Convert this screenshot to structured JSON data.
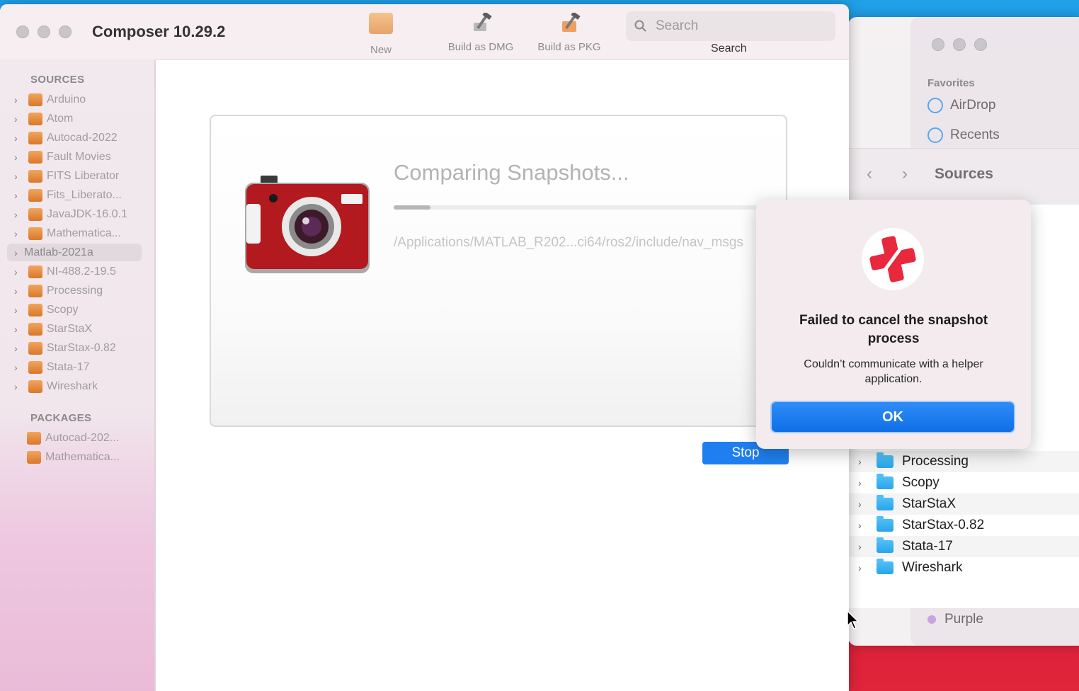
{
  "composer": {
    "title": "Composer 10.29.2",
    "toolbar": {
      "new_label": "New",
      "build_dmg_label": "Build as DMG",
      "build_pkg_label": "Build as PKG",
      "search_placeholder": "Search",
      "search_caption": "Search"
    },
    "sidebar": {
      "sources_label": "SOURCES",
      "sources": [
        {
          "label": "Arduino"
        },
        {
          "label": "Atom"
        },
        {
          "label": "Autocad-2022"
        },
        {
          "label": "Fault Movies"
        },
        {
          "label": "FITS Liberator"
        },
        {
          "label": "Fits_Liberato..."
        },
        {
          "label": "JavaJDK-16.0.1"
        },
        {
          "label": "Mathematica..."
        },
        {
          "label": "Matlab-2021a"
        },
        {
          "label": "NI-488.2-19.5"
        },
        {
          "label": "Processing"
        },
        {
          "label": "Scopy"
        },
        {
          "label": "StarStaX"
        },
        {
          "label": "StarStax-0.82"
        },
        {
          "label": "Stata-17"
        },
        {
          "label": "Wireshark"
        }
      ],
      "selected_source": "Matlab-2021a",
      "packages_label": "PACKAGES",
      "packages": [
        {
          "label": "Autocad-202..."
        },
        {
          "label": "Mathematica..."
        }
      ]
    },
    "progress": {
      "title": "Comparing Snapshots...",
      "fraction": 0.1,
      "path": "/Applications/MATLAB_R202...ci64/ros2/include/nav_msgs"
    },
    "stop_label": "Stop"
  },
  "alert": {
    "title": "Failed to cancel the snapshot process",
    "message": "Couldn’t communicate with a helper application.",
    "ok_label": "OK"
  },
  "finder": {
    "favorites_label": "Favorites",
    "favorites": [
      {
        "label": "AirDrop",
        "icon": "airdrop-icon"
      },
      {
        "label": "Recents",
        "icon": "clock-icon"
      }
    ],
    "title": "Sources",
    "items": [
      {
        "label": "Processing"
      },
      {
        "label": "Scopy"
      },
      {
        "label": "StarStaX"
      },
      {
        "label": "StarStax-0.82"
      },
      {
        "label": "Stata-17"
      },
      {
        "label": "Wireshark"
      }
    ],
    "tag_purple": "Purple"
  },
  "colors": {
    "accent": "#1f7ff0",
    "alert_icon_red": "#e8283c",
    "package_orange": "#e48a3c",
    "folder_blue": "#2aa4ea"
  }
}
